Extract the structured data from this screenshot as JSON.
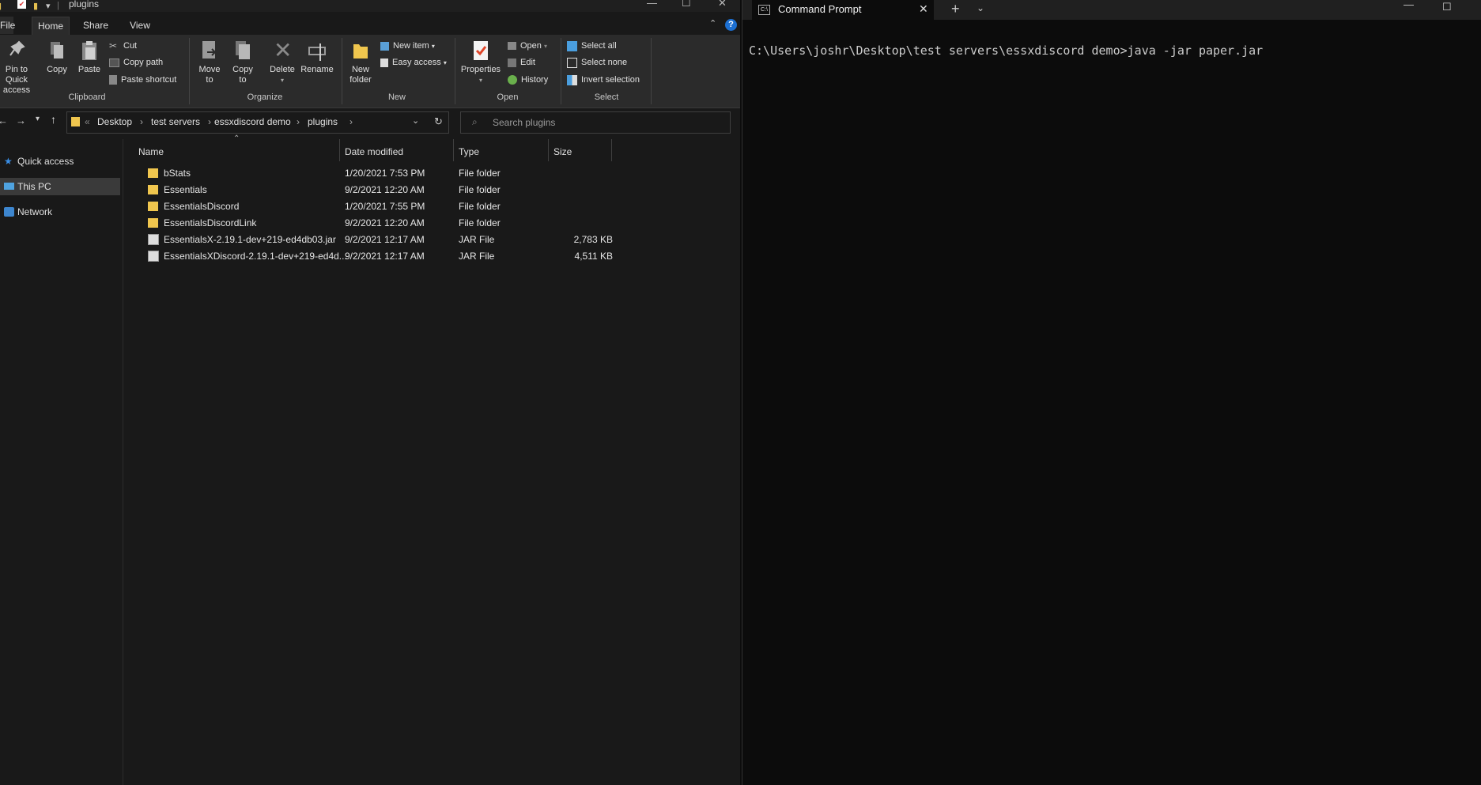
{
  "explorer": {
    "title": "plugins",
    "tabs": [
      "File",
      "Home",
      "Share",
      "View"
    ],
    "ribbon": {
      "clipboard": {
        "pin": "Pin to Quick access",
        "copy": "Copy",
        "paste": "Paste",
        "cut": "Cut",
        "copy_path": "Copy path",
        "paste_shortcut": "Paste shortcut",
        "group": "Clipboard"
      },
      "organize": {
        "move_to": "Move to",
        "copy_to": "Copy to",
        "delete": "Delete",
        "rename": "Rename",
        "group": "Organize"
      },
      "new": {
        "new_folder": "New folder",
        "new_item": "New item",
        "easy_access": "Easy access",
        "group": "New"
      },
      "open": {
        "properties": "Properties",
        "open": "Open",
        "edit": "Edit",
        "history": "History",
        "group": "Open"
      },
      "select": {
        "select_all": "Select all",
        "select_none": "Select none",
        "invert_selection": "Invert selection",
        "group": "Select"
      }
    },
    "breadcrumb": [
      "Desktop",
      "test servers",
      "essxdiscord demo",
      "plugins"
    ],
    "search_placeholder": "Search plugins",
    "nav": [
      "Quick access",
      "This PC",
      "Network"
    ],
    "columns": [
      "Name",
      "Date modified",
      "Type",
      "Size"
    ],
    "files": [
      {
        "name": "bStats",
        "date": "1/20/2021 7:53 PM",
        "type": "File folder",
        "size": "",
        "kind": "folder"
      },
      {
        "name": "Essentials",
        "date": "9/2/2021 12:20 AM",
        "type": "File folder",
        "size": "",
        "kind": "folder"
      },
      {
        "name": "EssentialsDiscord",
        "date": "1/20/2021 7:55 PM",
        "type": "File folder",
        "size": "",
        "kind": "folder"
      },
      {
        "name": "EssentialsDiscordLink",
        "date": "9/2/2021 12:20 AM",
        "type": "File folder",
        "size": "",
        "kind": "folder"
      },
      {
        "name": "EssentialsX-2.19.1-dev+219-ed4db03.jar",
        "date": "9/2/2021 12:17 AM",
        "type": "JAR File",
        "size": "2,783 KB",
        "kind": "jar"
      },
      {
        "name": "EssentialsXDiscord-2.19.1-dev+219-ed4d...",
        "date": "9/2/2021 12:17 AM",
        "type": "JAR File",
        "size": "4,511 KB",
        "kind": "jar"
      }
    ],
    "colors": {
      "folder": "#f0c64e",
      "accent": "#0078d4"
    }
  },
  "terminal": {
    "tab_title": "Command Prompt",
    "command_line": "C:\\Users\\joshr\\Desktop\\test servers\\essxdiscord demo>java -jar paper.jar"
  }
}
